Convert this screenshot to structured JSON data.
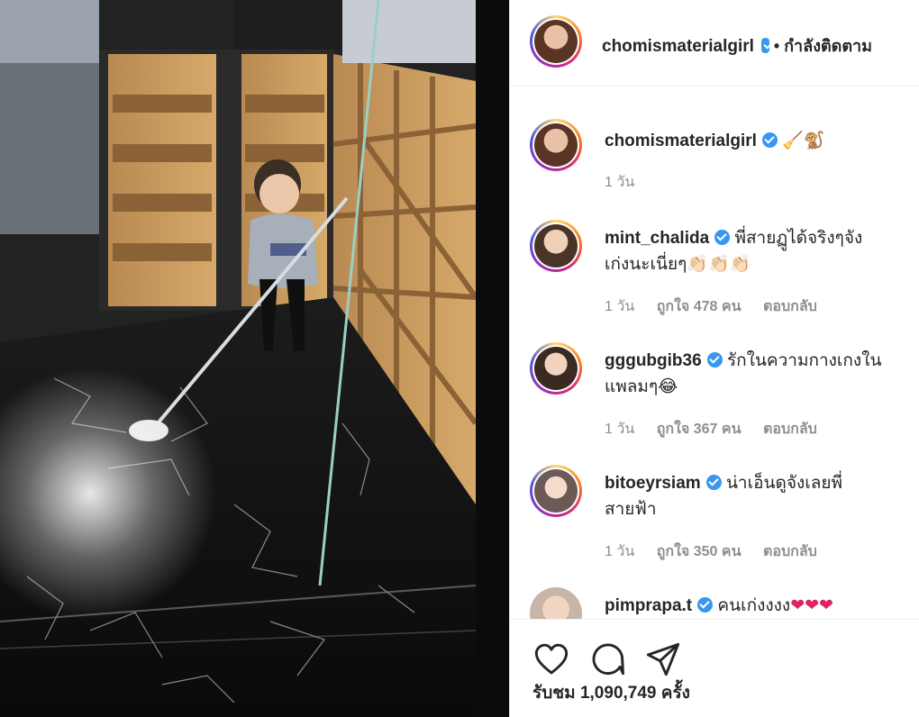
{
  "post": {
    "author": "chomismaterialgirl",
    "follow_state": "• กำลังติดตาม",
    "caption_emojis": "🧹🐒",
    "caption_time": "1 วัน",
    "views": "รับชม 1,090,749 ครั้ง"
  },
  "comments": [
    {
      "user": "mint_chalida",
      "text": "พี่สายฏูได้จริงๆจัง",
      "text2": "เก่งนะเนี่ยๆ",
      "emojis": "👏🏻👏🏻👏🏻",
      "time": "1 วัน",
      "likes": "ถูกใจ 478 คน",
      "reply": "ตอบกลับ"
    },
    {
      "user": "gggubgib36",
      "text": "รักในความกางเกงใน",
      "text2": "แพลมๆ",
      "emojis": "😂",
      "time": "1 วัน",
      "likes": "ถูกใจ 367 คน",
      "reply": "ตอบกลับ"
    },
    {
      "user": "bitoeyrsiam",
      "text": "น่าเอ็นดูจังเลยพี่",
      "text2": "สายฟ้า",
      "emojis": "",
      "time": "1 วัน",
      "likes": "ถูกใจ 350 คน",
      "reply": "ตอบกลับ"
    },
    {
      "user": "pimprapa.t",
      "text": "คนเก่งงงง",
      "text2": "",
      "emojis": "❤❤❤",
      "time": "",
      "likes": "",
      "reply": ""
    }
  ],
  "icons": [
    "heart-icon",
    "comment-icon",
    "share-icon",
    "verified-icon"
  ],
  "colors": {
    "verified": "#3897f0",
    "meta": "#8e8e8e",
    "text": "#262626",
    "heart": "#e0245e"
  }
}
